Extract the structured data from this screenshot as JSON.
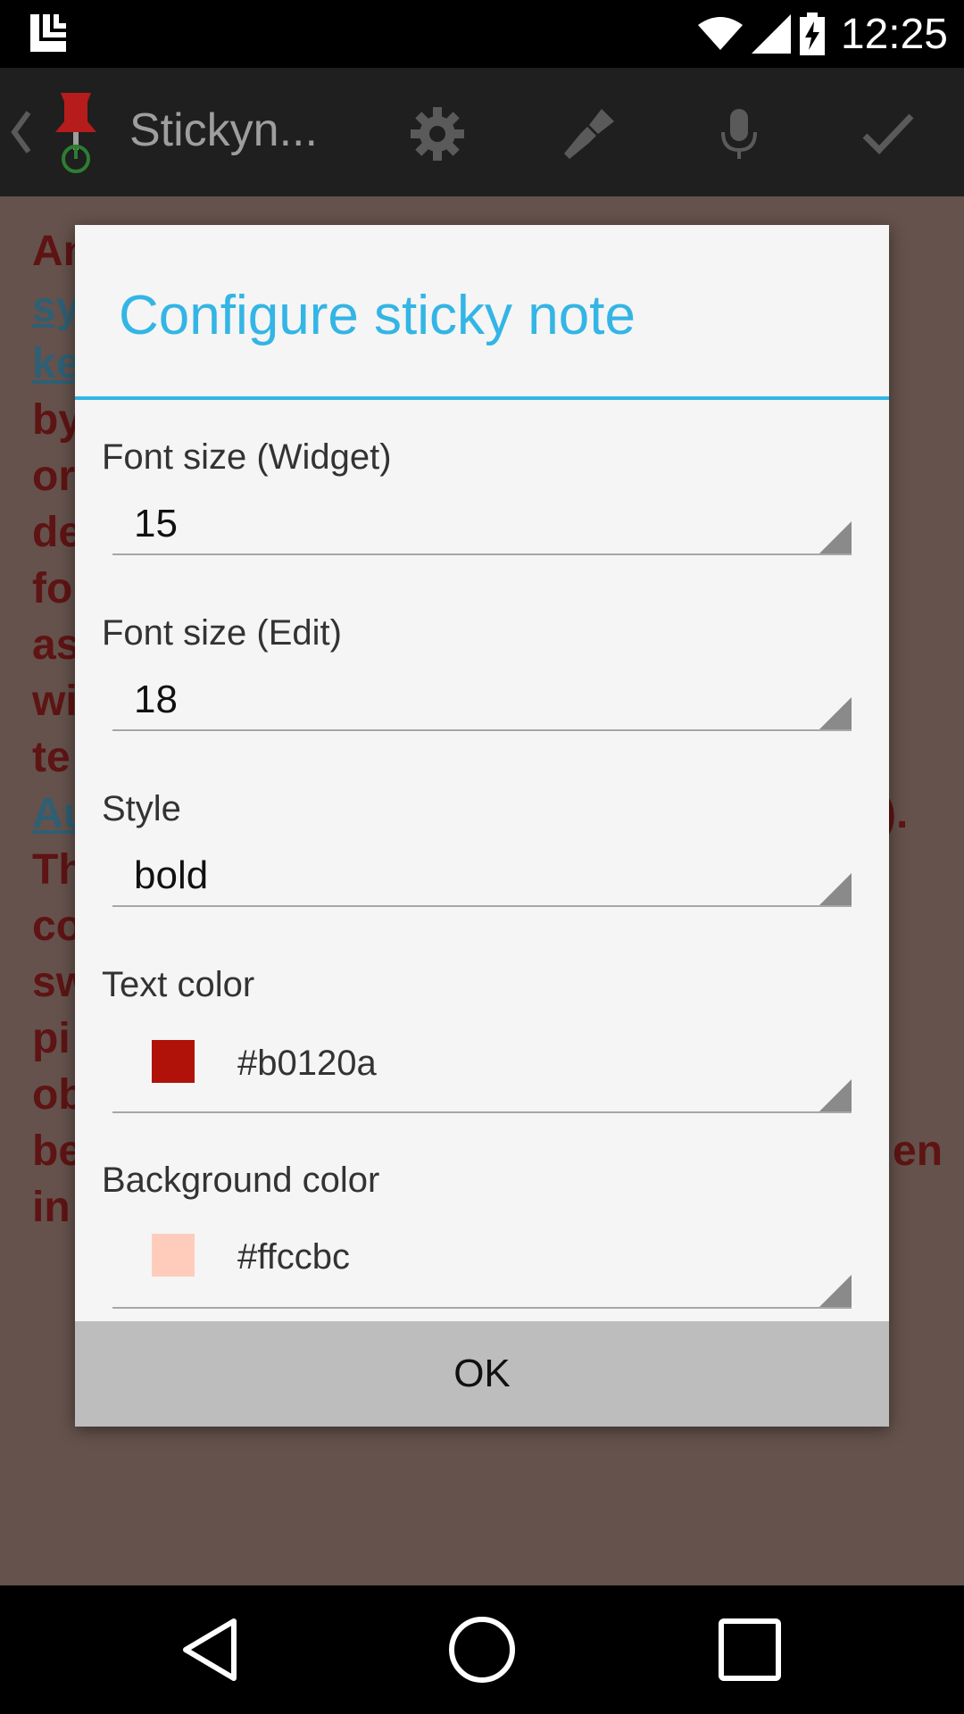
{
  "status_bar": {
    "time": "12:25"
  },
  "action_bar": {
    "title": "Stickyn...",
    "icons": [
      "back-chevron-icon",
      "pushpin-icon",
      "gear-icon",
      "brush-icon",
      "microphone-icon",
      "checkmark-icon"
    ]
  },
  "background_note": {
    "text_color": "#5e1414",
    "link_color": "#2f5f73",
    "background": "#65524c",
    "fragments": [
      "An",
      "sy",
      "ke",
      "by",
      "or",
      "de",
      "fo",
      "as",
      "wi",
      "te",
      "Au",
      ").",
      "Th",
      "co",
      "sw",
      "pi",
      "ob",
      "be",
      "en",
      "in"
    ]
  },
  "dialog": {
    "title": "Configure sticky note",
    "accent_color": "#33b5e5",
    "fields": {
      "font_size_widget": {
        "label": "Font size (Widget)",
        "value": "15"
      },
      "font_size_edit": {
        "label": "Font size (Edit)",
        "value": "18"
      },
      "style": {
        "label": "Style",
        "value": "bold"
      },
      "text_color": {
        "label": "Text color",
        "value": "#b0120a",
        "swatch": "#b0120a"
      },
      "background_color": {
        "label": "Background color",
        "value": "#ffccbc",
        "swatch": "#ffccbc"
      }
    },
    "ok_label": "OK"
  }
}
